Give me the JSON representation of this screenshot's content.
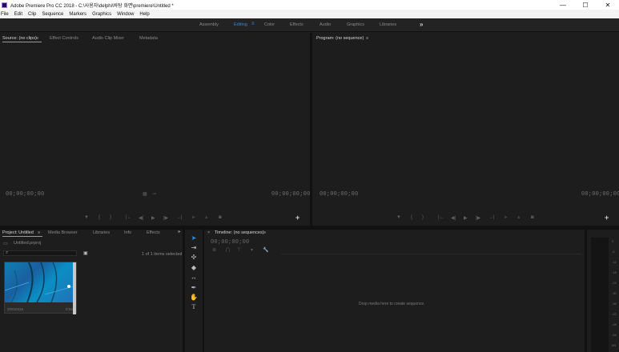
{
  "titlebar": {
    "title": "Adobe Premiere Pro CC 2018 - C:\\사용자\\delphi\\바탕 화면\\premiere\\Untitled *",
    "minimize": "—",
    "maximize": "☐",
    "close": "✕"
  },
  "menu": [
    "File",
    "Edit",
    "Clip",
    "Sequence",
    "Markers",
    "Graphics",
    "Window",
    "Help"
  ],
  "workspaces": {
    "items": [
      "Assembly",
      "Editing",
      "Color",
      "Effects",
      "Audio",
      "Graphics",
      "Libraries"
    ],
    "active": "Editing",
    "active_menu": "≡",
    "more": "»"
  },
  "source_panel": {
    "tabs": [
      "Source: (no clips)",
      "Effect Controls",
      "Audio Clip Mixer",
      "Metadata"
    ],
    "tab_menu": "≡",
    "timecode_left": "00;00;00;00",
    "timecode_right": "00;00;00;00",
    "add": "+"
  },
  "program_panel": {
    "tab": "Program: (no sequence)",
    "tab_menu": "≡",
    "timecode_left": "00;00;00;00",
    "timecode_right": "00;00;00;00",
    "add": "+"
  },
  "project_panel": {
    "tabs": [
      "Project: Untitled",
      "Media Browser",
      "Libraries",
      "Info",
      "Effects"
    ],
    "tab_menu": "≡",
    "more": "»",
    "project_file": "Untitled.prproj",
    "items_selected": "1 of 1 items selected",
    "clip_name": "20210415",
    "clip_duration": "0:04"
  },
  "timeline_panel": {
    "tab": "Timeline: (no sequences)",
    "tab_menu": "≡",
    "close": "×",
    "timecode": "00;00;00;00",
    "drop_message": "Drop media here to create sequence."
  },
  "audio_meter": {
    "ticks": [
      "0",
      "-6",
      "-12",
      "-18",
      "-24",
      "-30",
      "-36",
      "-42",
      "-48",
      "-54",
      "dB"
    ]
  },
  "colors": {
    "accent": "#2d8ceb",
    "panel_bg": "#1d1d1d",
    "chrome_bg": "#232323"
  }
}
